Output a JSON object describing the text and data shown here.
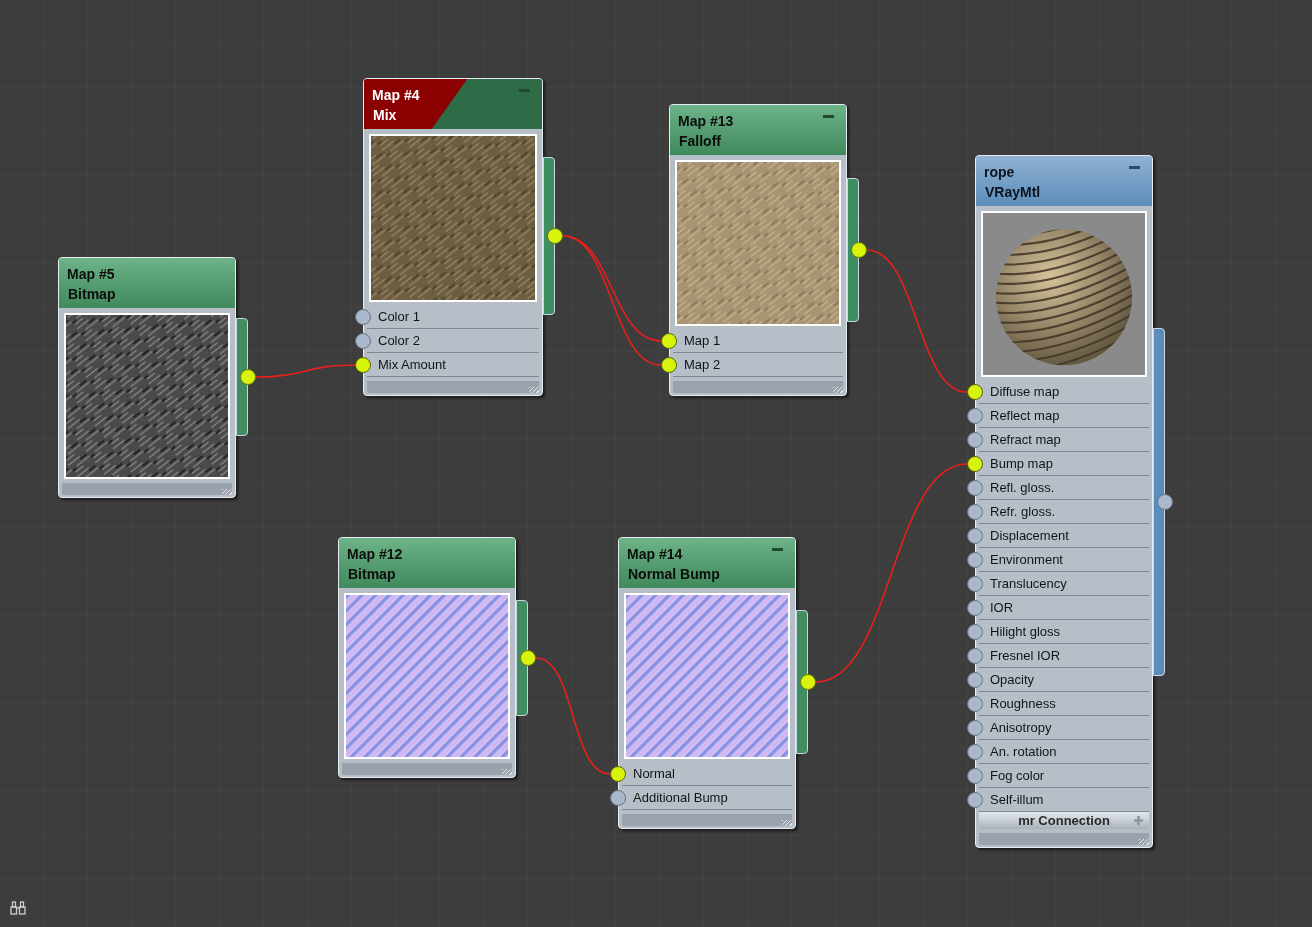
{
  "nodes": [
    {
      "title": "Map #5",
      "subtitle": "Bitmap",
      "header": {
        "kind": "map"
      },
      "minimize_button": false,
      "preview": {
        "kind": "gray-noise"
      },
      "output_connected": true
    },
    {
      "title": "Map #4",
      "subtitle": "Mix",
      "header": {
        "kind": "mix"
      },
      "minimize_button": true,
      "preview": {
        "kind": "wood"
      },
      "output_connected": true,
      "inputs": [
        {
          "label": "Color 1",
          "connected": false
        },
        {
          "label": "Color 2",
          "connected": false
        },
        {
          "label": "Mix Amount",
          "connected": true
        }
      ]
    },
    {
      "title": "Map #13",
      "subtitle": "Falloff",
      "header": {
        "kind": "map"
      },
      "minimize_button": true,
      "preview": {
        "kind": "falloff"
      },
      "output_connected": true,
      "inputs": [
        {
          "label": "Map 1",
          "connected": true
        },
        {
          "label": "Map 2",
          "connected": true
        }
      ]
    },
    {
      "title": "rope",
      "subtitle": "VRayMtl",
      "header": {
        "kind": "material"
      },
      "minimize_button": true,
      "preview": {
        "kind": "sphere"
      },
      "output_connected": false,
      "inputs": [
        {
          "label": "Diffuse map",
          "connected": true
        },
        {
          "label": "Reflect map",
          "connected": false
        },
        {
          "label": "Refract map",
          "connected": false
        },
        {
          "label": "Bump map",
          "connected": true
        },
        {
          "label": "Refl. gloss.",
          "connected": false
        },
        {
          "label": "Refr. gloss.",
          "connected": false
        },
        {
          "label": "Displacement",
          "connected": false
        },
        {
          "label": "Environment",
          "connected": false
        },
        {
          "label": "Translucency",
          "connected": false
        },
        {
          "label": "IOR",
          "connected": false
        },
        {
          "label": "Hilight gloss",
          "connected": false
        },
        {
          "label": "Fresnel IOR",
          "connected": false
        },
        {
          "label": "Opacity",
          "connected": false
        },
        {
          "label": "Roughness",
          "connected": false
        },
        {
          "label": "Anisotropy",
          "connected": false
        },
        {
          "label": "An. rotation",
          "connected": false
        },
        {
          "label": "Fog color",
          "connected": false
        },
        {
          "label": "Self-illum",
          "connected": false
        }
      ],
      "footer_bar": {
        "label": "mr Connection"
      }
    },
    {
      "title": "Map #12",
      "subtitle": "Bitmap",
      "header": {
        "kind": "map"
      },
      "minimize_button": false,
      "preview": {
        "kind": "normal-stripes"
      },
      "output_connected": true
    },
    {
      "title": "Map #14",
      "subtitle": "Normal Bump",
      "header": {
        "kind": "map"
      },
      "minimize_button": true,
      "preview": {
        "kind": "normal-stripes"
      },
      "output_connected": true,
      "inputs": [
        {
          "label": "Normal",
          "connected": true
        },
        {
          "label": "Additional Bump",
          "connected": false
        }
      ]
    }
  ]
}
